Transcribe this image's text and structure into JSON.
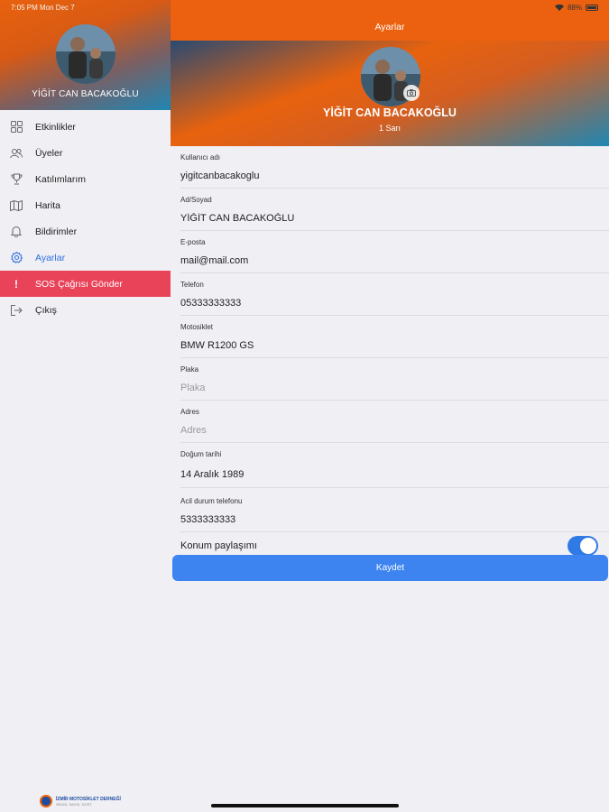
{
  "status_bar": {
    "time_date": "7:05 PM   Mon Dec 7",
    "battery": "88%"
  },
  "sidebar": {
    "user_name": "YİĞİT CAN BACAKOĞLU",
    "items": [
      {
        "label": "Etkinlikler",
        "icon": "grid-icon"
      },
      {
        "label": "Üyeler",
        "icon": "users-icon"
      },
      {
        "label": "Katılımlarım",
        "icon": "trophy-icon"
      },
      {
        "label": "Harita",
        "icon": "map-icon"
      },
      {
        "label": "Bildirimler",
        "icon": "bell-icon"
      },
      {
        "label": "Ayarlar",
        "icon": "gear-icon"
      },
      {
        "label": "SOS Çağrısı Gönder",
        "icon": "exclamation-icon"
      },
      {
        "label": "Çıkış",
        "icon": "logout-icon"
      }
    ],
    "logo_title": "İZMİR MOTOSİKLET DERNEĞİ",
    "logo_sub": "SEVGİ, SAYGI, DOST"
  },
  "header": {
    "title": "Ayarlar"
  },
  "profile": {
    "name": "YİĞİT CAN BACAKOĞLU",
    "subtitle": "1 Sarı"
  },
  "form": {
    "username": {
      "label": "Kullanıcı adı",
      "value": "yigitcanbacakoglu",
      "placeholder": ""
    },
    "fullname": {
      "label": "Ad/Soyad",
      "value": "YİĞİT CAN BACAKOĞLU",
      "placeholder": ""
    },
    "email": {
      "label": "E-posta",
      "value": "mail@mail.com",
      "placeholder": ""
    },
    "phone": {
      "label": "Telefon",
      "value": "05333333333",
      "placeholder": ""
    },
    "motorcycle": {
      "label": "Motosiklet",
      "value": "BMW R1200 GS",
      "placeholder": ""
    },
    "plate": {
      "label": "Plaka",
      "value": "",
      "placeholder": "Plaka"
    },
    "address": {
      "label": "Adres",
      "value": "",
      "placeholder": "Adres"
    },
    "birthdate": {
      "label": "Doğum tarihi",
      "value": "14 Aralık 1989",
      "placeholder": ""
    },
    "emergency_phone": {
      "label": "Acil durum telefonu",
      "value": "5333333333",
      "placeholder": ""
    },
    "location_sharing": {
      "label": "Konum paylaşımı",
      "enabled": true
    },
    "save_label": "Kaydet"
  },
  "colors": {
    "accent_orange": "#ec6110",
    "accent_blue": "#3d84f0",
    "sos_red": "#e84359",
    "active_blue": "#2f6fe0"
  }
}
